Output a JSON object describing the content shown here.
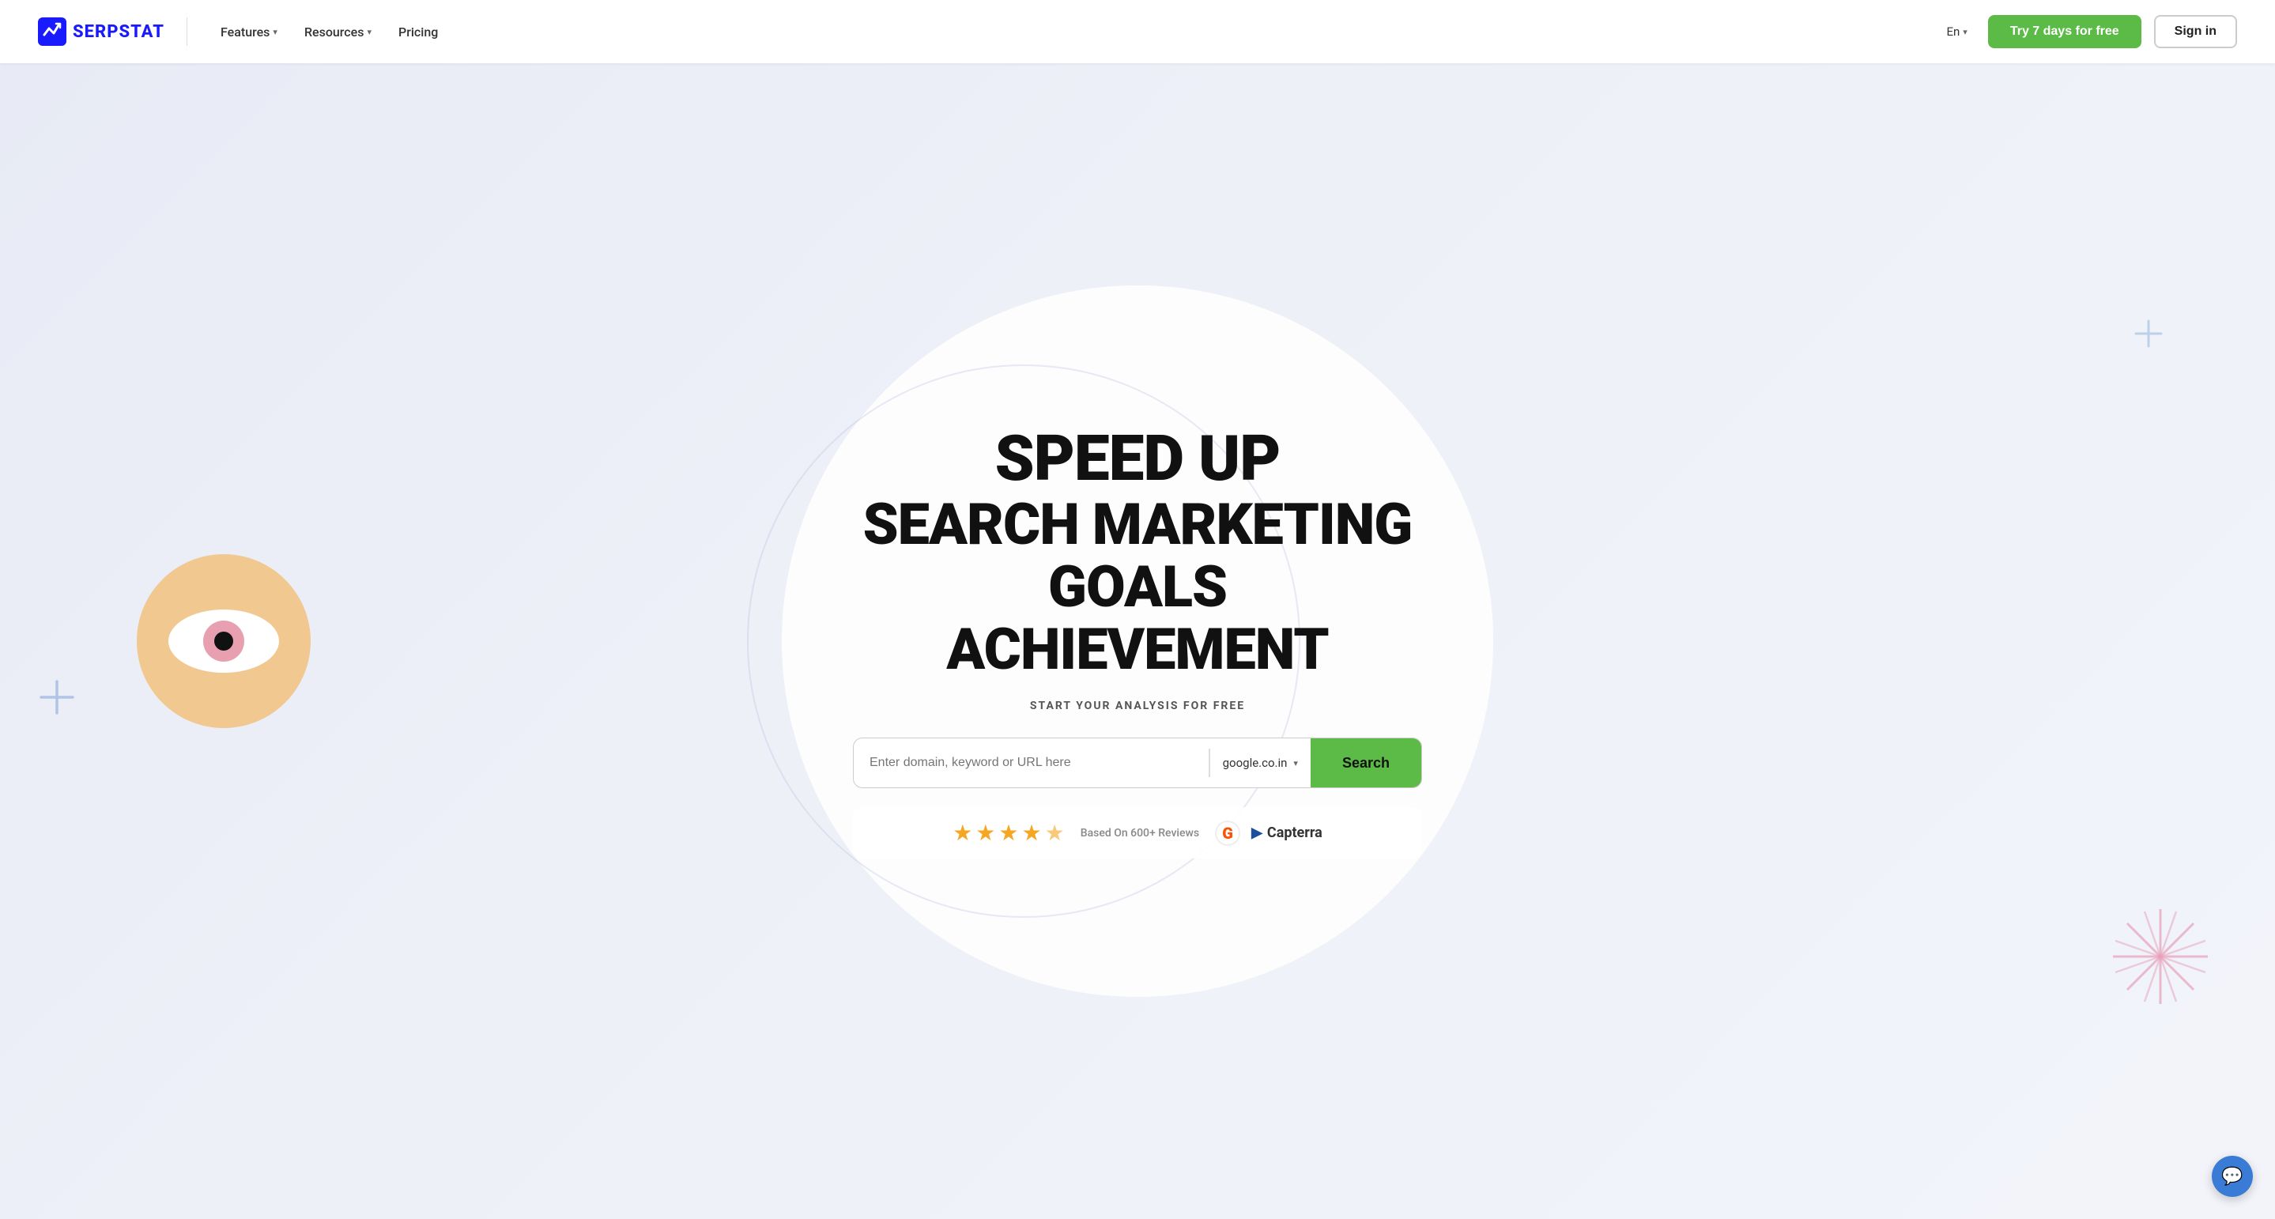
{
  "navbar": {
    "logo_text": "SERPSTAT",
    "nav_items": [
      {
        "label": "Features",
        "has_dropdown": true
      },
      {
        "label": "Resources",
        "has_dropdown": true
      },
      {
        "label": "Pricing",
        "has_dropdown": false
      }
    ],
    "lang": "En",
    "try_btn": "Try 7 days for free",
    "signin_btn": "Sign in"
  },
  "hero": {
    "title_line1": "SPEED UP",
    "title_line2": "SEARCH MARKETING",
    "title_line3": "GOALS ACHIEVEMENT",
    "subtitle": "START YOUR ANALYSIS FOR FREE",
    "search_placeholder": "Enter domain, keyword or URL here",
    "search_engine": "google.co.in",
    "search_btn": "Search",
    "reviews_text": "Based On 600+ Reviews",
    "capterra_text": "Capterra"
  },
  "chat": {
    "label": "💬"
  }
}
